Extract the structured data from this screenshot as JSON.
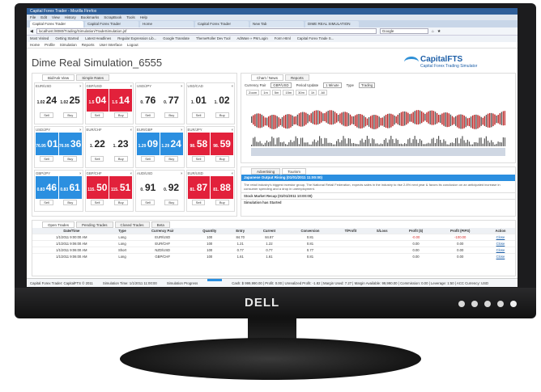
{
  "browser": {
    "window_title": "Capital Forex Trader - Mozilla Firefox",
    "menu": [
      "File",
      "Edit",
      "View",
      "History",
      "Bookmarks",
      "ScrapBook",
      "Tools",
      "Help"
    ],
    "tabs": [
      "Capital Forex Trader",
      "Capital Forex Trader",
      "Home",
      "Capital Forex Trader",
      "New Tab",
      "DIME REAL SIMULATION"
    ],
    "address": "localhost:/8080/Trading/Simulation/TradeSimulation.jsf",
    "search_placeholder": "Google",
    "bookmarks": [
      "Most Visited",
      "Getting Started",
      "Latest Headlines",
      "Regular Expression Lib...",
      "Google Translate",
      "ThemeRoller Dev Tool",
      "AdWare » PM Login",
      "Form Html",
      "Capital Forex Trade S..."
    ]
  },
  "app": {
    "nav": [
      "Home",
      "Profile",
      "Simulation",
      "Reports",
      "User Interface",
      "Logout"
    ],
    "title": "Dime Real Simulation_6555",
    "logo_main": "CapitalFTS",
    "logo_sub": "Capital Forex Trading Simulator"
  },
  "rates": {
    "tabs": [
      "Bid/Ask View",
      "Simple Rates"
    ],
    "tiles": [
      {
        "pair": "EUR/USD",
        "left": "24",
        "right": "25",
        "style": "plain",
        "lp": "1.02",
        "rp": "1.02"
      },
      {
        "pair": "GBP/USD",
        "left": "04",
        "right": "14",
        "style": "red",
        "lp": "1.5",
        "rp": "1.5"
      },
      {
        "pair": "USD/JPY",
        "left": "76",
        "right": "77",
        "style": "plain",
        "lp": "0.",
        "rp": "0."
      },
      {
        "pair": "USD/CAD",
        "left": "01",
        "right": "02",
        "style": "plain",
        "lp": "1.",
        "rp": "1."
      },
      {
        "pair": "USD/JPY",
        "left": "01",
        "right": "36",
        "style": "blue",
        "lp": "76.95",
        "rp": "76.95"
      },
      {
        "pair": "EUR/CHF",
        "left": "22",
        "right": "23",
        "style": "plain",
        "lp": "1.",
        "rp": "1."
      },
      {
        "pair": "EUR/GBP",
        "left": "09",
        "right": "24",
        "style": "blue",
        "lp": "1.29",
        "rp": "1.29"
      },
      {
        "pair": "EUR/JPY",
        "left": "58",
        "right": "59",
        "style": "red",
        "lp": "98.",
        "rp": "98."
      },
      {
        "pair": "GBP/JPY",
        "left": "46",
        "right": "61",
        "style": "blue",
        "lp": "0.83",
        "rp": "0.83"
      },
      {
        "pair": "GBP/CHF",
        "left": "50",
        "right": "51",
        "style": "red",
        "lp": "115.",
        "rp": "115."
      },
      {
        "pair": "AUD/USD",
        "left": "91",
        "right": "92",
        "style": "plain",
        "lp": "0.",
        "rp": "0."
      },
      {
        "pair": "EUR/USD",
        "left": "87",
        "right": "88",
        "style": "red",
        "lp": "81.",
        "rp": "81."
      }
    ],
    "sell": "Sell",
    "buy": "Buy"
  },
  "chart": {
    "tabs": [
      "Chart / News",
      "Reports"
    ],
    "currency_pair_label": "Currency Pair",
    "currency_pair": "GBP/USD",
    "period_label": "Period Update",
    "period": "1 Minute",
    "type_label": "Type",
    "type": "Trading",
    "zoom": [
      "Zoom",
      "1m",
      "5m",
      "15m",
      "30m",
      "1h",
      "All"
    ]
  },
  "news": {
    "tabs": [
      "Advertising",
      "Tourism"
    ],
    "headline": "Japanese Output Rising (01/01/2011 11:00:00)",
    "body": "The retail industry's biggest investor group, The National Retail Federation, expects sales in the industry to rise 2.8% next year & favors its conclusion on an anticipated increase in consumer spending and a drop in unemployment.",
    "items": [
      "Stock Market Recap (01/01/2011 10:00:00)",
      "Simulation has Started"
    ]
  },
  "trades": {
    "tabs": [
      "Open Trades",
      "Pending Trades",
      "Closed Trades",
      "Beta"
    ],
    "columns": [
      "Date/Time",
      "Type",
      "Currency Pair",
      "Quantity",
      "Entry",
      "Current",
      "Conversion",
      "T/Profit",
      "S/Loss",
      "Profit ($)",
      "Profit (PIPS)",
      "Action"
    ],
    "rows": [
      [
        "1/1/2011 9:00:00 AM",
        "Long",
        "EUR/USD",
        "100",
        "84.70",
        "84.87",
        "0.81",
        "",
        "",
        "-0.00",
        "-100.00",
        "Close"
      ],
      [
        "1/1/2011 9:06:00 AM",
        "Long",
        "EUR/CHF",
        "100",
        "1.21",
        "1.22",
        "0.81",
        "",
        "",
        "0.00",
        "0.00",
        "Close"
      ],
      [
        "1/1/2011 9:06:00 AM",
        "Short",
        "NZD/USD",
        "100",
        "0.77",
        "0.77",
        "0.77",
        "",
        "",
        "0.00",
        "0.00",
        "Close"
      ],
      [
        "1/1/2011 9:06:00 AM",
        "Long",
        "GBP/CHF",
        "100",
        "1.61",
        "1.61",
        "0.81",
        "",
        "",
        "0.00",
        "0.00",
        "Close"
      ]
    ]
  },
  "status": {
    "left": "Capital Forex Trader: CapitalFTS © 2011",
    "time": "Simulation Time: 1/1/2011 11:00:00",
    "progress_label": "Simulation Progress",
    "progress": 0.6,
    "account": "Cash: $ 999,990.00 | Profit: 0.00 | Unrealized Profit: -1.82 | Margin Used: 7.27 | Margin Available: 99,990.00 | Commission: 0.00 | Leverage: 1:50 | ACC Currency: USD"
  },
  "monitor": {
    "brand": "DELL"
  }
}
